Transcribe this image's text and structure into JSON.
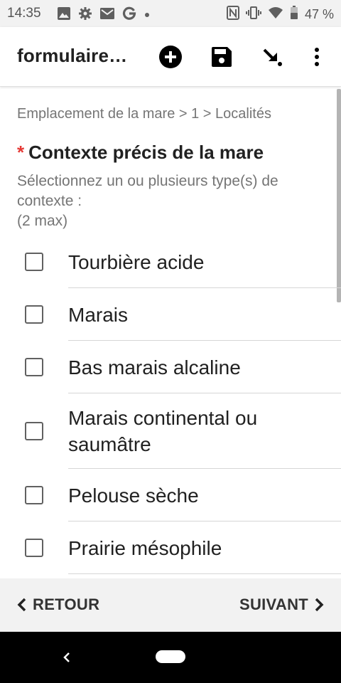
{
  "status_bar": {
    "time": "14:35",
    "left_icons": [
      "image-icon",
      "gear-icon",
      "mail-icon",
      "google-icon",
      "dot-icon"
    ],
    "right_icons": [
      "nfc-icon",
      "vibrate-icon",
      "wifi-icon",
      "battery-icon"
    ],
    "battery_percent": "47 %"
  },
  "toolbar": {
    "title": "formulaire…",
    "actions": [
      "add-icon",
      "save-icon",
      "arrow-icon",
      "more-vert-icon"
    ]
  },
  "form": {
    "breadcrumb": "Emplacement de la mare > 1 > Localités",
    "required_marker": "*",
    "question": "Contexte précis de la mare",
    "hint": "Sélectionnez un ou plusieurs type(s) de contexte :\n(2 max)",
    "options": [
      {
        "label": "Tourbière acide",
        "checked": false
      },
      {
        "label": "Marais",
        "checked": false
      },
      {
        "label": "Bas marais alcaline",
        "checked": false
      },
      {
        "label": "Marais continental ou saumâtre",
        "checked": false
      },
      {
        "label": "Pelouse sèche",
        "checked": false
      },
      {
        "label": "Prairie mésophile",
        "checked": false
      }
    ]
  },
  "navigation": {
    "back_label": "RETOUR",
    "next_label": "SUIVANT"
  },
  "colors": {
    "required": "#e53935",
    "bar_background": "#f2f2f2",
    "text_primary": "#212121",
    "text_secondary": "#757575"
  }
}
